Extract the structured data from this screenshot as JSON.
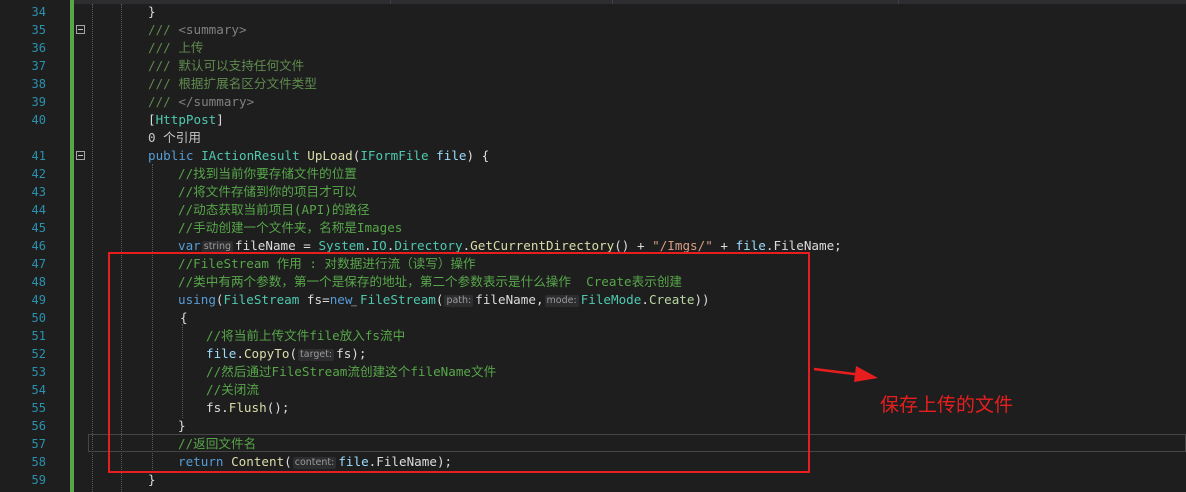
{
  "editor": {
    "colors": {
      "background": "#1e1e1e",
      "line_number": "#2b91af",
      "keyword": "#569cd6",
      "type": "#4ec9b0",
      "comment": "#57a64a",
      "string": "#d69d85",
      "annotation": "#e81e1e",
      "change_bar": "#57a64a"
    },
    "lines": [
      {
        "num": "34",
        "fold": false,
        "parts": [
          {
            "t": "pl",
            "v": "}"
          }
        ]
      },
      {
        "num": "35",
        "fold": true,
        "parts": [
          {
            "t": "doc",
            "v": "/// "
          },
          {
            "t": "tag",
            "v": "<summary>"
          }
        ]
      },
      {
        "num": "36",
        "fold": false,
        "parts": [
          {
            "t": "doc",
            "v": "/// 上传"
          }
        ]
      },
      {
        "num": "37",
        "fold": false,
        "parts": [
          {
            "t": "doc",
            "v": "/// 默认可以支持任何文件"
          }
        ]
      },
      {
        "num": "38",
        "fold": false,
        "parts": [
          {
            "t": "doc",
            "v": "/// 根据扩展名区分文件类型"
          }
        ]
      },
      {
        "num": "39",
        "fold": false,
        "parts": [
          {
            "t": "doc",
            "v": "/// "
          },
          {
            "t": "tag",
            "v": "</summary>"
          }
        ]
      },
      {
        "num": "40",
        "fold": false,
        "parts": [
          {
            "t": "pl",
            "v": "["
          },
          {
            "t": "attr",
            "v": "HttpPost"
          },
          {
            "t": "pl",
            "v": "]"
          }
        ]
      },
      {
        "num": "",
        "fold": false,
        "parts": [
          {
            "t": "ref",
            "v": "0 个引用"
          }
        ]
      },
      {
        "num": "41",
        "fold": true,
        "parts": [
          {
            "t": "kw",
            "v": "public "
          },
          {
            "t": "type",
            "v": "IActionResult"
          },
          {
            "t": "pl",
            "v": " "
          },
          {
            "t": "meth",
            "v": "UpLoad"
          },
          {
            "t": "pl",
            "v": "("
          },
          {
            "t": "type",
            "v": "IFormFile"
          },
          {
            "t": "par",
            "v": " file"
          },
          {
            "t": "pl",
            "v": ") {"
          }
        ]
      },
      {
        "num": "42",
        "fold": false,
        "parts": [
          {
            "t": "cm",
            "v": "//找到当前你要存储文件的位置"
          }
        ]
      },
      {
        "num": "43",
        "fold": false,
        "parts": [
          {
            "t": "cm",
            "v": "//将文件存储到你的项目才可以"
          }
        ]
      },
      {
        "num": "44",
        "fold": false,
        "parts": [
          {
            "t": "cm",
            "v": "//动态获取当前项目(API)的路径"
          }
        ]
      },
      {
        "num": "45",
        "fold": false,
        "parts": [
          {
            "t": "cm",
            "v": "//手动创建一个文件夹，名称是Images"
          }
        ]
      },
      {
        "num": "46",
        "fold": false,
        "parts": [
          {
            "t": "kw",
            "v": "var"
          },
          {
            "t": "hint",
            "v": "string"
          },
          {
            "t": "id",
            "v": "fileName"
          },
          {
            "t": "pl",
            "v": " = "
          },
          {
            "t": "type",
            "v": "System"
          },
          {
            "t": "pl",
            "v": "."
          },
          {
            "t": "type",
            "v": "IO"
          },
          {
            "t": "pl",
            "v": "."
          },
          {
            "t": "type",
            "v": "Directory"
          },
          {
            "t": "pl",
            "v": "."
          },
          {
            "t": "meth",
            "v": "GetCurrentDirectory"
          },
          {
            "t": "pl",
            "v": "() + "
          },
          {
            "t": "str",
            "v": "\"/Imgs/\""
          },
          {
            "t": "pl",
            "v": " + "
          },
          {
            "t": "par",
            "v": "file"
          },
          {
            "t": "pl",
            "v": "."
          },
          {
            "t": "prop",
            "v": "FileName"
          },
          {
            "t": "pl",
            "v": ";"
          }
        ]
      },
      {
        "num": "47",
        "fold": false,
        "parts": [
          {
            "t": "cm",
            "v": "//FileStream 作用 : 对数据进行流（读写）操作"
          }
        ]
      },
      {
        "num": "48",
        "fold": false,
        "parts": [
          {
            "t": "cm",
            "v": "//类中有两个参数，第一个是保存的地址，第二个参数表示是什么操作  Create表示创建"
          }
        ]
      },
      {
        "num": "49",
        "fold": false,
        "parts": [
          {
            "t": "kw",
            "v": "using"
          },
          {
            "t": "pl",
            "v": "("
          },
          {
            "t": "type",
            "v": "FileStream"
          },
          {
            "t": "pl",
            "v": " fs="
          },
          {
            "t": "kw",
            "v": "new "
          },
          {
            "t": "type",
            "v": "FileStream"
          },
          {
            "t": "pl",
            "v": "("
          },
          {
            "t": "hint",
            "v": "path:"
          },
          {
            "t": "id",
            "v": "fileName"
          },
          {
            "t": "pl",
            "v": ","
          },
          {
            "t": "hint",
            "v": "mode:"
          },
          {
            "t": "type",
            "v": "FileMode"
          },
          {
            "t": "pl",
            "v": "."
          },
          {
            "t": "enum",
            "v": "Create"
          },
          {
            "t": "pl",
            "v": "))"
          }
        ]
      },
      {
        "num": "50",
        "fold": false,
        "parts": [
          {
            "t": "pl",
            "v": "{"
          }
        ]
      },
      {
        "num": "51",
        "fold": false,
        "parts": [
          {
            "t": "cm",
            "v": "//将当前上传文件file放入fs流中"
          }
        ]
      },
      {
        "num": "52",
        "fold": false,
        "parts": [
          {
            "t": "par",
            "v": "file"
          },
          {
            "t": "pl",
            "v": "."
          },
          {
            "t": "meth",
            "v": "CopyTo"
          },
          {
            "t": "pl",
            "v": "("
          },
          {
            "t": "hint",
            "v": "target:"
          },
          {
            "t": "id",
            "v": "fs"
          },
          {
            "t": "pl",
            "v": ");"
          }
        ]
      },
      {
        "num": "53",
        "fold": false,
        "parts": [
          {
            "t": "cm",
            "v": "//然后通过FileStream流创建这个fileName文件"
          }
        ]
      },
      {
        "num": "54",
        "fold": false,
        "parts": [
          {
            "t": "cm",
            "v": "//关闭流"
          }
        ]
      },
      {
        "num": "55",
        "fold": false,
        "parts": [
          {
            "t": "id",
            "v": "fs"
          },
          {
            "t": "pl",
            "v": "."
          },
          {
            "t": "meth",
            "v": "Flush"
          },
          {
            "t": "pl",
            "v": "();"
          }
        ]
      },
      {
        "num": "56",
        "fold": false,
        "parts": [
          {
            "t": "pl",
            "v": "}"
          }
        ]
      },
      {
        "num": "57",
        "fold": false,
        "parts": [
          {
            "t": "cm",
            "v": "//返回文件名"
          }
        ]
      },
      {
        "num": "58",
        "fold": false,
        "parts": [
          {
            "t": "kw",
            "v": "return "
          },
          {
            "t": "meth",
            "v": "Content"
          },
          {
            "t": "pl",
            "v": "("
          },
          {
            "t": "hint",
            "v": "content:"
          },
          {
            "t": "par",
            "v": "file"
          },
          {
            "t": "pl",
            "v": "."
          },
          {
            "t": "prop",
            "v": "FileName"
          },
          {
            "t": "pl",
            "v": ");"
          }
        ]
      },
      {
        "num": "59",
        "fold": false,
        "parts": [
          {
            "t": "pl",
            "v": "}"
          }
        ]
      }
    ]
  },
  "annotation": {
    "text": "保存上传的文件"
  }
}
